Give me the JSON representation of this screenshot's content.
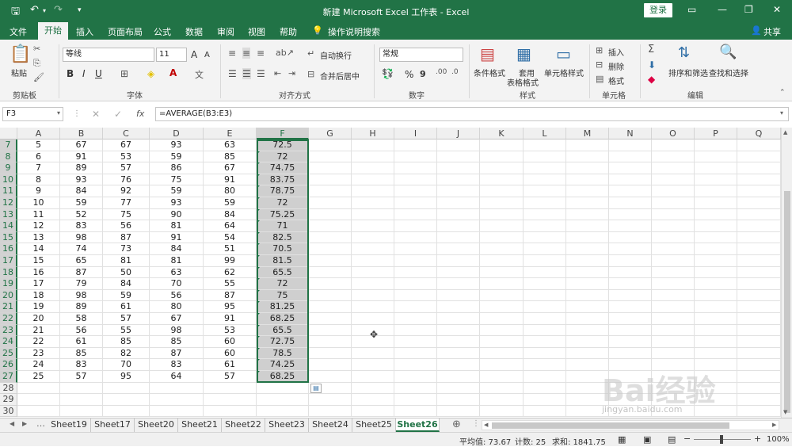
{
  "window": {
    "title": "新建 Microsoft Excel 工作表 - Excel",
    "login": "登录"
  },
  "menu": {
    "file": "文件",
    "home": "开始",
    "insert": "插入",
    "page_layout": "页面布局",
    "formulas": "公式",
    "data": "数据",
    "review": "审阅",
    "view": "视图",
    "help": "帮助",
    "search": "操作说明搜索",
    "share": "共享"
  },
  "ribbon": {
    "clipboard": {
      "paste": "粘贴",
      "label": "剪贴板"
    },
    "font": {
      "name": "等线",
      "size": "11",
      "label": "字体",
      "bold": "B",
      "italic": "I",
      "underline": "U",
      "grow": "A",
      "shrink": "A"
    },
    "alignment": {
      "wrap": "自动换行",
      "merge": "合并后居中",
      "label": "对齐方式"
    },
    "number": {
      "format": "常规",
      "percent": "%",
      "comma": "9",
      "label": "数字"
    },
    "styles": {
      "cond": "条件格式",
      "table_line1": "套用",
      "table_line2": "表格格式",
      "cell": "单元格样式",
      "label": "样式"
    },
    "cells": {
      "insert": "插入",
      "delete": "删除",
      "format": "格式",
      "label": "单元格"
    },
    "editing": {
      "sort": "排序和筛选",
      "find": "查找和选择",
      "label": "编辑"
    }
  },
  "formula_bar": {
    "name_box": "F3",
    "formula": "=AVERAGE(B3:E3)",
    "fx": "fx"
  },
  "columns": [
    "A",
    "B",
    "C",
    "D",
    "E",
    "F",
    "G",
    "H",
    "I",
    "J",
    "K",
    "L",
    "M",
    "N",
    "O",
    "P",
    "Q"
  ],
  "rows": [
    {
      "r": "7",
      "v": [
        "5",
        "67",
        "67",
        "93",
        "63",
        "72.5"
      ]
    },
    {
      "r": "8",
      "v": [
        "6",
        "91",
        "53",
        "59",
        "85",
        "72"
      ]
    },
    {
      "r": "9",
      "v": [
        "7",
        "89",
        "57",
        "86",
        "67",
        "74.75"
      ]
    },
    {
      "r": "10",
      "v": [
        "8",
        "93",
        "76",
        "75",
        "91",
        "83.75"
      ]
    },
    {
      "r": "11",
      "v": [
        "9",
        "84",
        "92",
        "59",
        "80",
        "78.75"
      ]
    },
    {
      "r": "12",
      "v": [
        "10",
        "59",
        "77",
        "93",
        "59",
        "72"
      ]
    },
    {
      "r": "13",
      "v": [
        "11",
        "52",
        "75",
        "90",
        "84",
        "75.25"
      ]
    },
    {
      "r": "14",
      "v": [
        "12",
        "83",
        "56",
        "81",
        "64",
        "71"
      ]
    },
    {
      "r": "15",
      "v": [
        "13",
        "98",
        "87",
        "91",
        "54",
        "82.5"
      ]
    },
    {
      "r": "16",
      "v": [
        "14",
        "74",
        "73",
        "84",
        "51",
        "70.5"
      ]
    },
    {
      "r": "17",
      "v": [
        "15",
        "65",
        "81",
        "81",
        "99",
        "81.5"
      ]
    },
    {
      "r": "18",
      "v": [
        "16",
        "87",
        "50",
        "63",
        "62",
        "65.5"
      ]
    },
    {
      "r": "19",
      "v": [
        "17",
        "79",
        "84",
        "70",
        "55",
        "72"
      ]
    },
    {
      "r": "20",
      "v": [
        "18",
        "98",
        "59",
        "56",
        "87",
        "75"
      ]
    },
    {
      "r": "21",
      "v": [
        "19",
        "89",
        "61",
        "80",
        "95",
        "81.25"
      ]
    },
    {
      "r": "22",
      "v": [
        "20",
        "58",
        "57",
        "67",
        "91",
        "68.25"
      ]
    },
    {
      "r": "23",
      "v": [
        "21",
        "56",
        "55",
        "98",
        "53",
        "65.5"
      ]
    },
    {
      "r": "24",
      "v": [
        "22",
        "61",
        "85",
        "85",
        "60",
        "72.75"
      ]
    },
    {
      "r": "25",
      "v": [
        "23",
        "85",
        "82",
        "87",
        "60",
        "78.5"
      ]
    },
    {
      "r": "26",
      "v": [
        "24",
        "83",
        "70",
        "83",
        "61",
        "74.25"
      ]
    },
    {
      "r": "27",
      "v": [
        "25",
        "57",
        "95",
        "64",
        "57",
        "68.25"
      ]
    },
    {
      "r": "28",
      "v": [
        "",
        "",
        "",
        "",
        "",
        ""
      ]
    },
    {
      "r": "29",
      "v": [
        "",
        "",
        "",
        "",
        "",
        ""
      ]
    },
    {
      "r": "30",
      "v": [
        "",
        "",
        "",
        "",
        "",
        ""
      ]
    }
  ],
  "sheets": [
    "Sheet19",
    "Sheet17",
    "Sheet20",
    "Sheet21",
    "Sheet22",
    "Sheet23",
    "Sheet24",
    "Sheet25",
    "Sheet26"
  ],
  "active_sheet": "Sheet26",
  "status": {
    "average": "平均值: 73.67",
    "count": "计数: 25",
    "sum": "求和: 1841.75",
    "zoom": "100%"
  },
  "watermark": {
    "brand": "Bai经验",
    "url": "jingyan.baidu.com"
  },
  "colors": {
    "accent": "#217346"
  }
}
